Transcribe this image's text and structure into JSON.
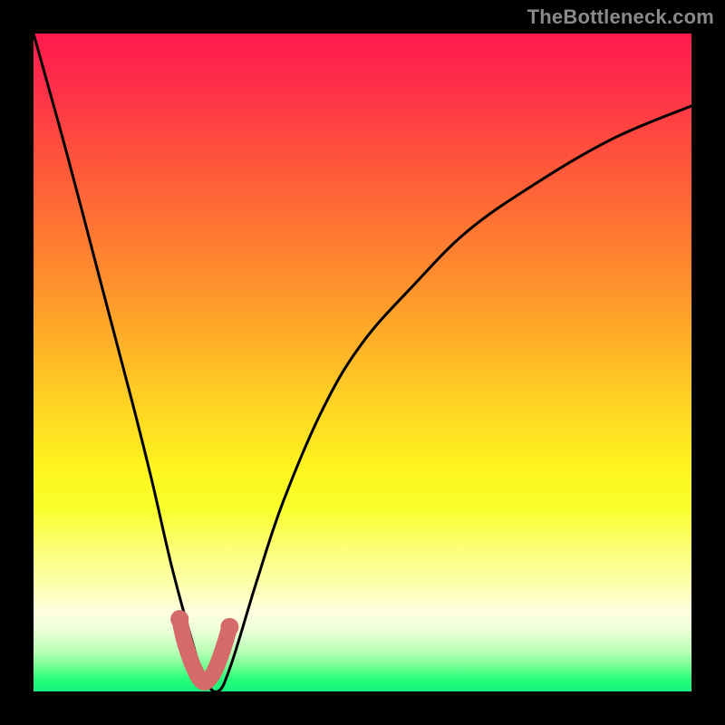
{
  "attribution": "TheBottleneck.com",
  "chart_data": {
    "type": "line",
    "title": "",
    "xlabel": "",
    "ylabel": "",
    "xlim": [
      0,
      100
    ],
    "ylim": [
      0,
      100
    ],
    "grid": false,
    "legend": false,
    "series": [
      {
        "name": "bottleneck-curve",
        "x": [
          0,
          5,
          10,
          15,
          18,
          21,
          24,
          26,
          28,
          30,
          34,
          38,
          44,
          50,
          58,
          66,
          76,
          88,
          100
        ],
        "y": [
          100,
          82,
          63,
          44,
          32,
          19,
          8,
          2,
          0,
          4,
          17,
          29,
          43,
          53,
          62,
          70,
          77,
          84,
          89
        ]
      },
      {
        "name": "highlight-min",
        "x": [
          22.2,
          22.8,
          23.6,
          24.4,
          25.2,
          26.0,
          26.8,
          27.6,
          28.4,
          29.2,
          29.8
        ],
        "y": [
          11.0,
          8.2,
          5.6,
          3.5,
          2.0,
          1.4,
          2.0,
          3.3,
          5.3,
          7.7,
          9.8
        ]
      }
    ],
    "gradient_stops": [
      {
        "pos": 0,
        "color": "#ff1a4d"
      },
      {
        "pos": 16,
        "color": "#ff4a3f"
      },
      {
        "pos": 36,
        "color": "#ff8a2e"
      },
      {
        "pos": 56,
        "color": "#ffd224"
      },
      {
        "pos": 72,
        "color": "#f8ff2a"
      },
      {
        "pos": 88,
        "color": "#ffffe0"
      },
      {
        "pos": 100,
        "color": "#12f07c"
      }
    ]
  }
}
